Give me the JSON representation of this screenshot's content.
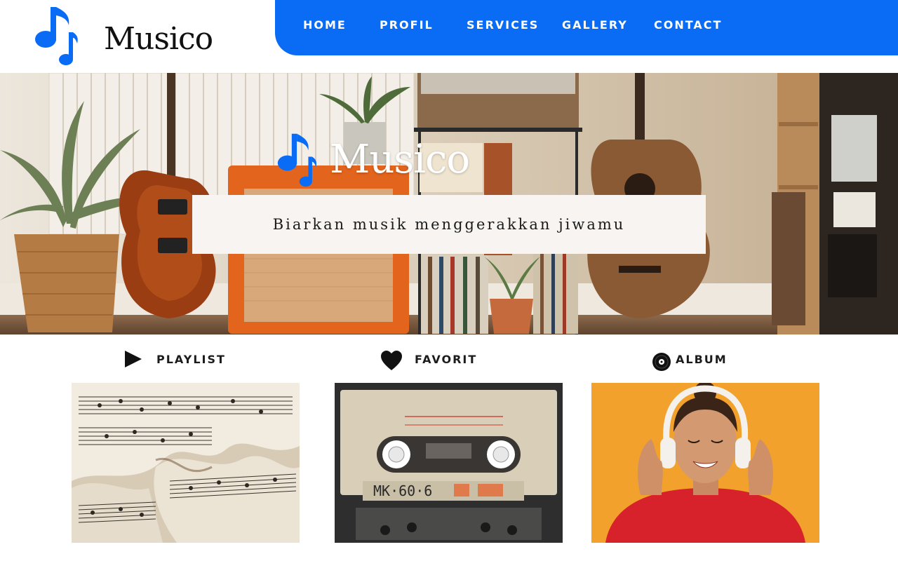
{
  "header": {
    "brand": "Musico",
    "logo_icon": "music-note-icon",
    "nav": [
      {
        "label": "HOME"
      },
      {
        "label": "PROFIL"
      },
      {
        "label": "SERVICES"
      },
      {
        "label": "GALLERY"
      },
      {
        "label": "CONTACT"
      }
    ]
  },
  "hero": {
    "brand": "Musico",
    "tagline": "Biarkan musik menggerakkan jiwamu"
  },
  "cards": [
    {
      "label": "PLAYLIST",
      "icon": "play-icon",
      "image": "sheet-music-image"
    },
    {
      "label": "FAVORIT",
      "icon": "heart-icon",
      "image": "cassette-tape-image",
      "tape_label": "MK·60·6"
    },
    {
      "label": "ALBUM",
      "icon": "vinyl-record-icon",
      "image": "woman-headphones-image"
    }
  ],
  "colors": {
    "accent": "#0a6cf5",
    "text_dark": "#111111",
    "tagline_bg": "#f7f4f1",
    "album_bg": "#f2a22c"
  }
}
